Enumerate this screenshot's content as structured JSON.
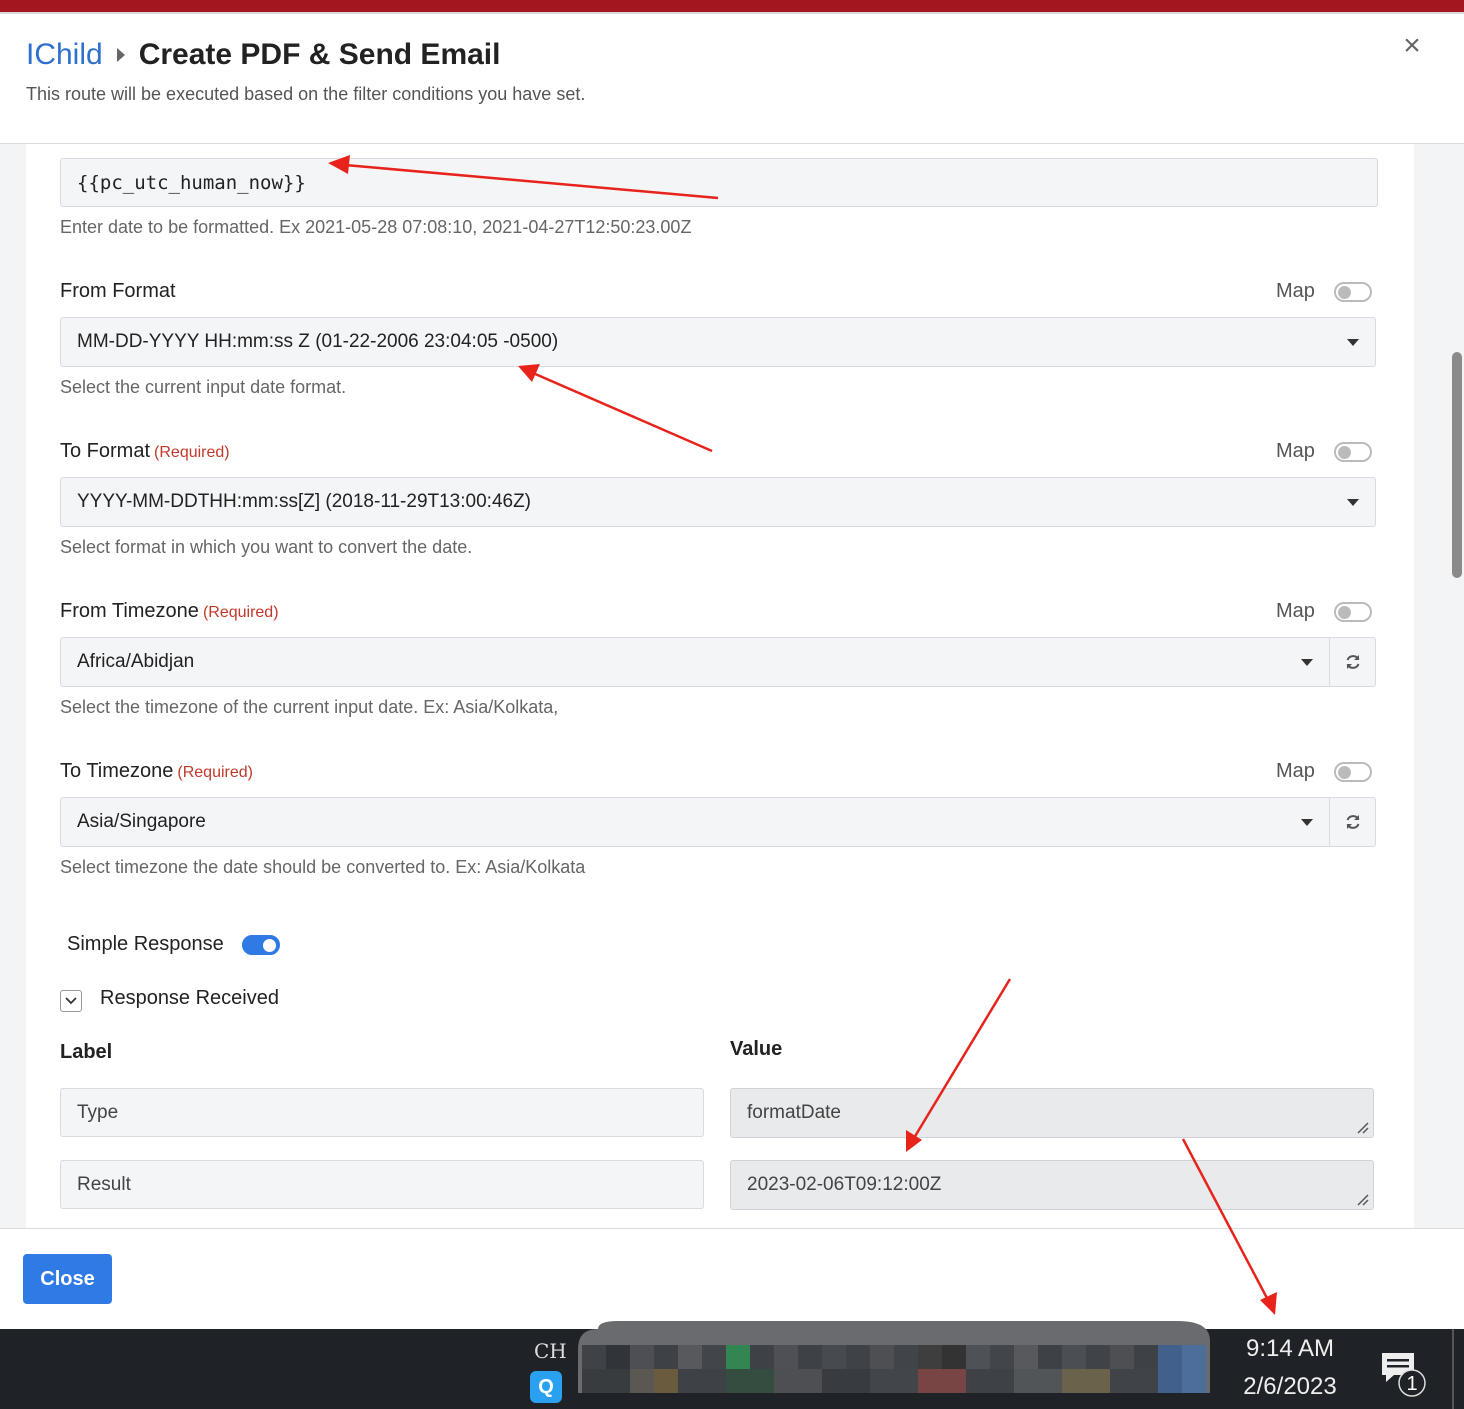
{
  "header": {
    "breadcrumb_link": "IChild",
    "title": "Create PDF & Send Email",
    "subtitle": "This route will be executed based on the filter conditions you have set.",
    "close_symbol": "×"
  },
  "form": {
    "date_input": {
      "value": "{{pc_utc_human_now}}",
      "help": "Enter date to be formatted. Ex 2021-05-28 07:08:10, 2021-04-27T12:50:23.00Z"
    },
    "from_format": {
      "label": "From Format",
      "map_label": "Map",
      "map_on": false,
      "value": "MM-DD-YYYY HH:mm:ss Z (01-22-2006 23:04:05 -0500)",
      "help": "Select the current input date format."
    },
    "to_format": {
      "label": "To Format",
      "required": "(Required)",
      "map_label": "Map",
      "map_on": false,
      "value": "YYYY-MM-DDTHH:mm:ss[Z] (2018-11-29T13:00:46Z)",
      "help": "Select format in which you want to convert the date."
    },
    "from_timezone": {
      "label": "From Timezone",
      "required": "(Required)",
      "map_label": "Map",
      "map_on": false,
      "value": "Africa/Abidjan",
      "help": "Select the timezone of the current input date. Ex: Asia/Kolkata,"
    },
    "to_timezone": {
      "label": "To Timezone",
      "required": "(Required)",
      "map_label": "Map",
      "map_on": false,
      "value": "Asia/Singapore",
      "help": "Select timezone the date should be converted to. Ex: Asia/Kolkata"
    },
    "simple_response": {
      "label": "Simple Response",
      "on": true
    },
    "response_received": {
      "label": "Response Received",
      "col_label": "Label",
      "col_value": "Value",
      "rows": [
        {
          "label": "Type",
          "value": "formatDate"
        },
        {
          "label": "Result",
          "value": "2023-02-06T09:12:00Z"
        }
      ]
    }
  },
  "footer": {
    "close_label": "Close"
  },
  "taskbar": {
    "input_lang": "CH",
    "app_letter": "Q",
    "time": "9:14 AM",
    "date": "2/6/2023",
    "notification_count": "1"
  },
  "colors": {
    "accent": "#2f7ae5",
    "topbar": "#a3161f",
    "required": "#c0392b",
    "annotation_arrow": "#e8231c"
  }
}
